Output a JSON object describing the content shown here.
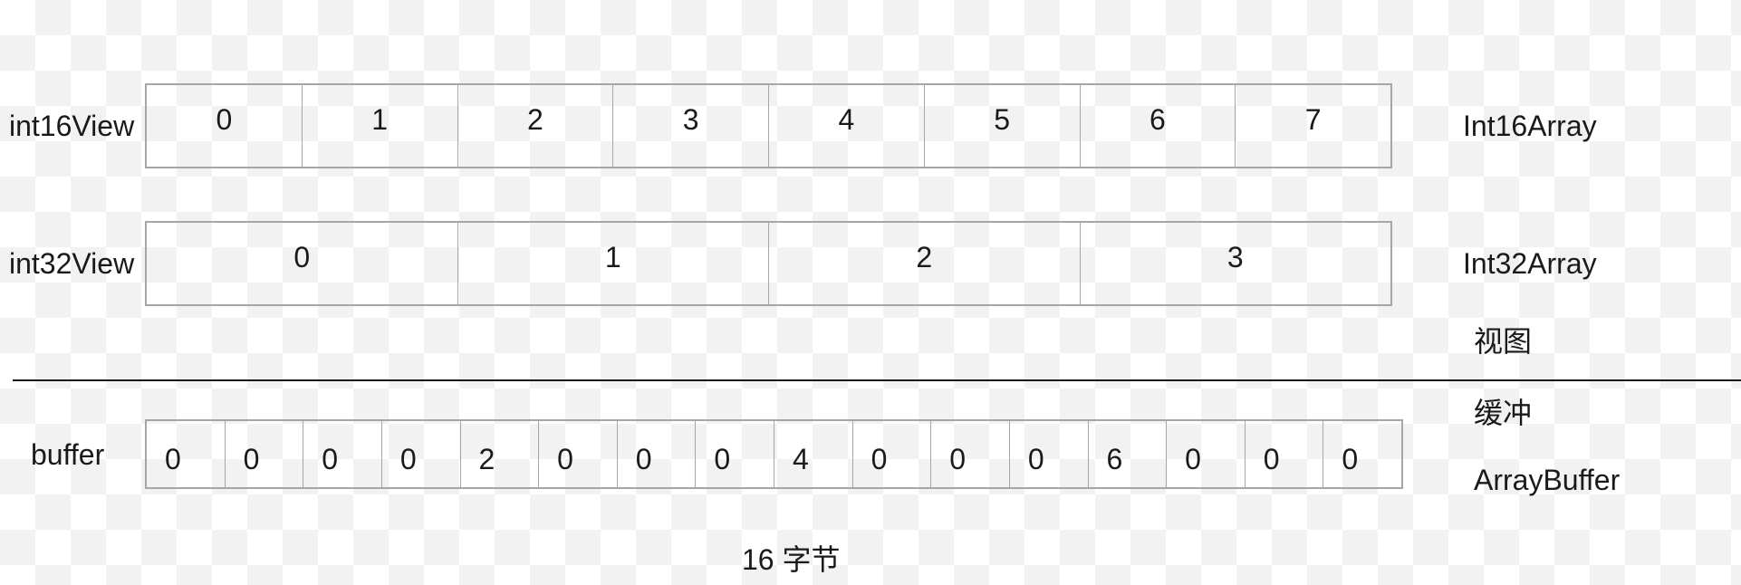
{
  "rows": {
    "int16": {
      "name": "int16View",
      "type": "Int16Array",
      "cells": [
        "0",
        "1",
        "2",
        "3",
        "4",
        "5",
        "6",
        "7"
      ]
    },
    "int32": {
      "name": "int32View",
      "type": "Int32Array",
      "cells": [
        "0",
        "1",
        "2",
        "3"
      ]
    },
    "buffer": {
      "name": "buffer",
      "type": "ArrayBuffer",
      "cells": [
        "0",
        "0",
        "0",
        "0",
        "2",
        "0",
        "0",
        "0",
        "4",
        "0",
        "0",
        "0",
        "6",
        "0",
        "0",
        "0"
      ]
    }
  },
  "labels": {
    "view": "视图",
    "buffer": "缓冲",
    "size": "16 字节"
  }
}
